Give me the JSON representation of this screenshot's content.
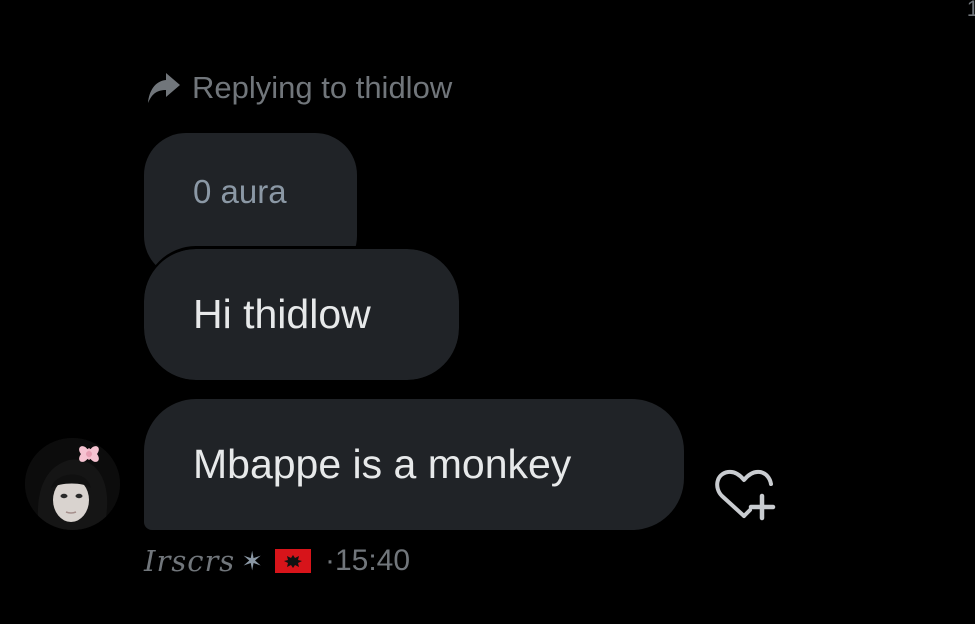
{
  "top_right_count": "1",
  "reply": {
    "text": "Replying to thidlow",
    "icon": "reply-arrow-icon"
  },
  "quoted_message": {
    "text": "0 aura"
  },
  "messages": [
    {
      "text": "Hi thidlow"
    },
    {
      "text": "Mbappe is a monkey"
    }
  ],
  "sender": {
    "name": "Irscrs",
    "symbol": "✶",
    "flag": "albania-flag-icon",
    "avatar": "user-avatar"
  },
  "timestamp": "·15:40",
  "reaction_button": {
    "icon": "add-reaction-heart-icon"
  },
  "colors": {
    "background": "#000000",
    "bubble": "#202327",
    "primary_text": "#e7e9ea",
    "secondary_text": "#71767b",
    "flag_red": "#d7141a"
  }
}
